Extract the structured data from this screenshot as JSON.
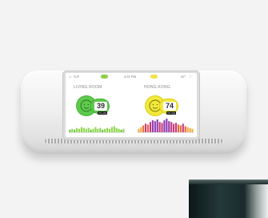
{
  "background": {
    "color": "#f3f3f3"
  },
  "device": {
    "color": "#f0f0f0",
    "screen": {
      "status_bar": {
        "left_reading": "°C/F",
        "time": "4:37 PM",
        "right_reading": "22°"
      },
      "panels": [
        {
          "location": "LIVING ROOM",
          "aqi": "39",
          "unit": "US AQI",
          "face_color": "#5ec94c",
          "history": [
            3,
            4,
            3,
            5,
            4,
            6,
            5,
            4,
            5,
            3,
            4,
            6,
            4,
            5,
            3,
            4,
            5,
            4,
            6,
            7,
            5,
            4,
            3,
            4
          ]
        },
        {
          "location": "HONG KONG",
          "aqi": "74",
          "unit": "US AQI",
          "face_color": "#f2e93a",
          "history": [
            4,
            6,
            8,
            10,
            9,
            12,
            14,
            13,
            15,
            12,
            11,
            14,
            16,
            13,
            12,
            10,
            11,
            9,
            8,
            10,
            7,
            6,
            5,
            4
          ]
        }
      ]
    }
  }
}
